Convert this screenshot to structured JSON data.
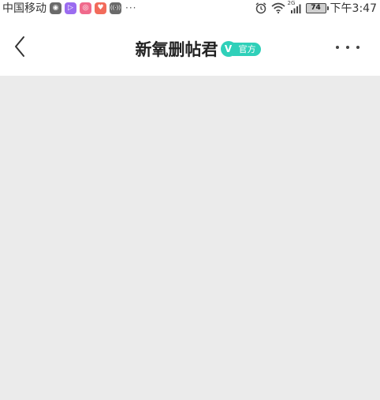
{
  "status_bar": {
    "carrier": "中国移动",
    "more": "···",
    "network": "2G",
    "battery": "74",
    "time": "下午3:47",
    "app_icons": [
      {
        "name": "camera-app-icon",
        "color": "#6a6a6a",
        "glyph": "◉"
      },
      {
        "name": "video-app-icon",
        "color": "#9b6cf0",
        "glyph": "▷"
      },
      {
        "name": "music-app-icon",
        "color": "#f06a8c",
        "glyph": "◎"
      },
      {
        "name": "gift-app-icon",
        "color": "#f26b5b",
        "glyph": "♥"
      },
      {
        "name": "radio-app-icon",
        "color": "#6a6a6a",
        "glyph": "((·))"
      }
    ]
  },
  "nav": {
    "title": "新氧删帖君",
    "badge_v": "V",
    "badge_text": "官方"
  },
  "colors": {
    "accent": "#2fd0b9",
    "background": "#ebebeb",
    "nav_background": "#ffffff"
  }
}
